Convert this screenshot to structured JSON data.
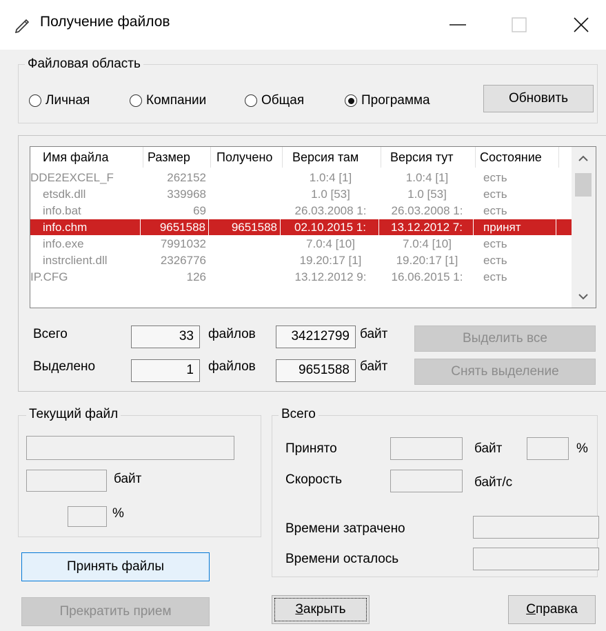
{
  "window": {
    "title": "Получение файлов",
    "minimize_glyph": "—",
    "maximize_glyph": "☐",
    "close_glyph": "✕"
  },
  "area": {
    "legend": "Файловая область",
    "options": [
      "Личная",
      "Компании",
      "Общая",
      "Программа"
    ],
    "selected": "Программа",
    "refresh_label": "Обновить"
  },
  "files": {
    "columns": [
      "Имя файла",
      "Размер",
      "Получено",
      "Версия там",
      "Версия тут",
      "Состояние"
    ],
    "rows": [
      [
        "DDE2EXCEL_F",
        "262152",
        "",
        "1.0:4 [1]",
        "1.0:4 [1]",
        "есть"
      ],
      [
        "etsdk.dll",
        "339968",
        "",
        "1.0 [53]",
        "1.0 [53]",
        "есть"
      ],
      [
        "info.bat",
        "69",
        "",
        "26.03.2008 1:",
        "26.03.2008 1:",
        "есть"
      ],
      [
        "info.chm",
        "9651588",
        "9651588",
        "02.10.2015 1:",
        "13.12.2012 7:",
        "принят"
      ],
      [
        "info.exe",
        "7991032",
        "",
        "7.0:4 [10]",
        "7.0:4 [10]",
        "есть"
      ],
      [
        "instrclient.dll",
        "2326776",
        "",
        "19.20:17 [1]",
        "19.20:17 [1]",
        "есть"
      ],
      [
        "IP.CFG",
        "126",
        "",
        "13.12.2012 9:",
        "16.06.2015 1:",
        "есть"
      ]
    ],
    "selected_row": 3,
    "scroll_up_glyph": "⌃",
    "scroll_down_glyph": "⌄"
  },
  "totals": {
    "total_label": "Всего",
    "total_files": "33",
    "total_files_unit": "файлов",
    "total_bytes": "34212799",
    "total_bytes_unit": "байт",
    "select_all_label": "Выделить все",
    "selected_label": "Выделено",
    "selected_files": "1",
    "selected_files_unit": "файлов",
    "selected_bytes": "9651588",
    "selected_bytes_unit": "байт",
    "deselect_label": "Снять выделение"
  },
  "current": {
    "legend": "Текущий файл",
    "file_value": "",
    "bytes_value": "",
    "bytes_unit": "байт",
    "percent_value": "",
    "percent_unit": "%"
  },
  "overall": {
    "legend": "Всего",
    "received_label": "Принято",
    "received_value": "",
    "received_unit": "байт",
    "received_pct_value": "",
    "pct_unit": "%",
    "speed_label": "Скорость",
    "speed_value": "",
    "speed_unit": "байт/с",
    "elapsed_label": "Времени затрачено",
    "elapsed_value": "",
    "remaining_label": "Времени осталось",
    "remaining_value": ""
  },
  "buttons": {
    "receive_label": "Принять файлы",
    "stop_label": "Прекратить прием",
    "close_mnemonic": "З",
    "close_rest": "акрыть",
    "help_mnemonic": "С",
    "help_rest": "правка"
  }
}
